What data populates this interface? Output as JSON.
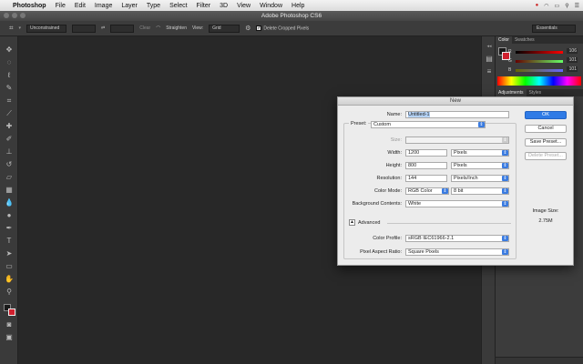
{
  "menubar": {
    "app": "Photoshop",
    "items": [
      "File",
      "Edit",
      "Image",
      "Layer",
      "Type",
      "Select",
      "Filter",
      "3D",
      "View",
      "Window",
      "Help"
    ]
  },
  "window": {
    "title": "Adobe Photoshop CS6"
  },
  "options": {
    "ratio": "Unconstrained",
    "straighten": "Straighten",
    "view_label": "View:",
    "view_value": "Grid",
    "delete_cropped": "Delete Cropped Pixels",
    "workspace": "Essentials"
  },
  "panels": {
    "color_tabs": [
      "Color",
      "Swatches"
    ],
    "r_label": "R",
    "r_value": "106",
    "g_label": "G",
    "g_value": "101",
    "b_label": "B",
    "b_value": "101",
    "adj_tabs": [
      "Adjustments",
      "Styles"
    ]
  },
  "dialog": {
    "title": "New",
    "name_label": "Name:",
    "name_value": "Untitled-1",
    "preset_label": "Preset:",
    "preset_value": "Custom",
    "size_label": "Size:",
    "width_label": "Width:",
    "width_value": "1200",
    "width_unit": "Pixels",
    "height_label": "Height:",
    "height_value": "800",
    "height_unit": "Pixels",
    "resolution_label": "Resolution:",
    "resolution_value": "144",
    "resolution_unit": "Pixels/Inch",
    "color_mode_label": "Color Mode:",
    "color_mode_value": "RGB Color",
    "bit_depth": "8 bit",
    "background_label": "Background Contents:",
    "background_value": "White",
    "advanced_label": "Advanced",
    "profile_label": "Color Profile:",
    "profile_value": "sRGB IEC61966-2.1",
    "pixel_aspect_label": "Pixel Aspect Ratio:",
    "pixel_aspect_value": "Square Pixels",
    "ok": "OK",
    "cancel": "Cancel",
    "save_preset": "Save Preset...",
    "delete_preset": "Delete Preset...",
    "image_size_label": "Image Size:",
    "image_size_value": "2.75M"
  },
  "colors": {
    "accent": "#2f7be6",
    "foreground_swatch": "#d0202e"
  }
}
